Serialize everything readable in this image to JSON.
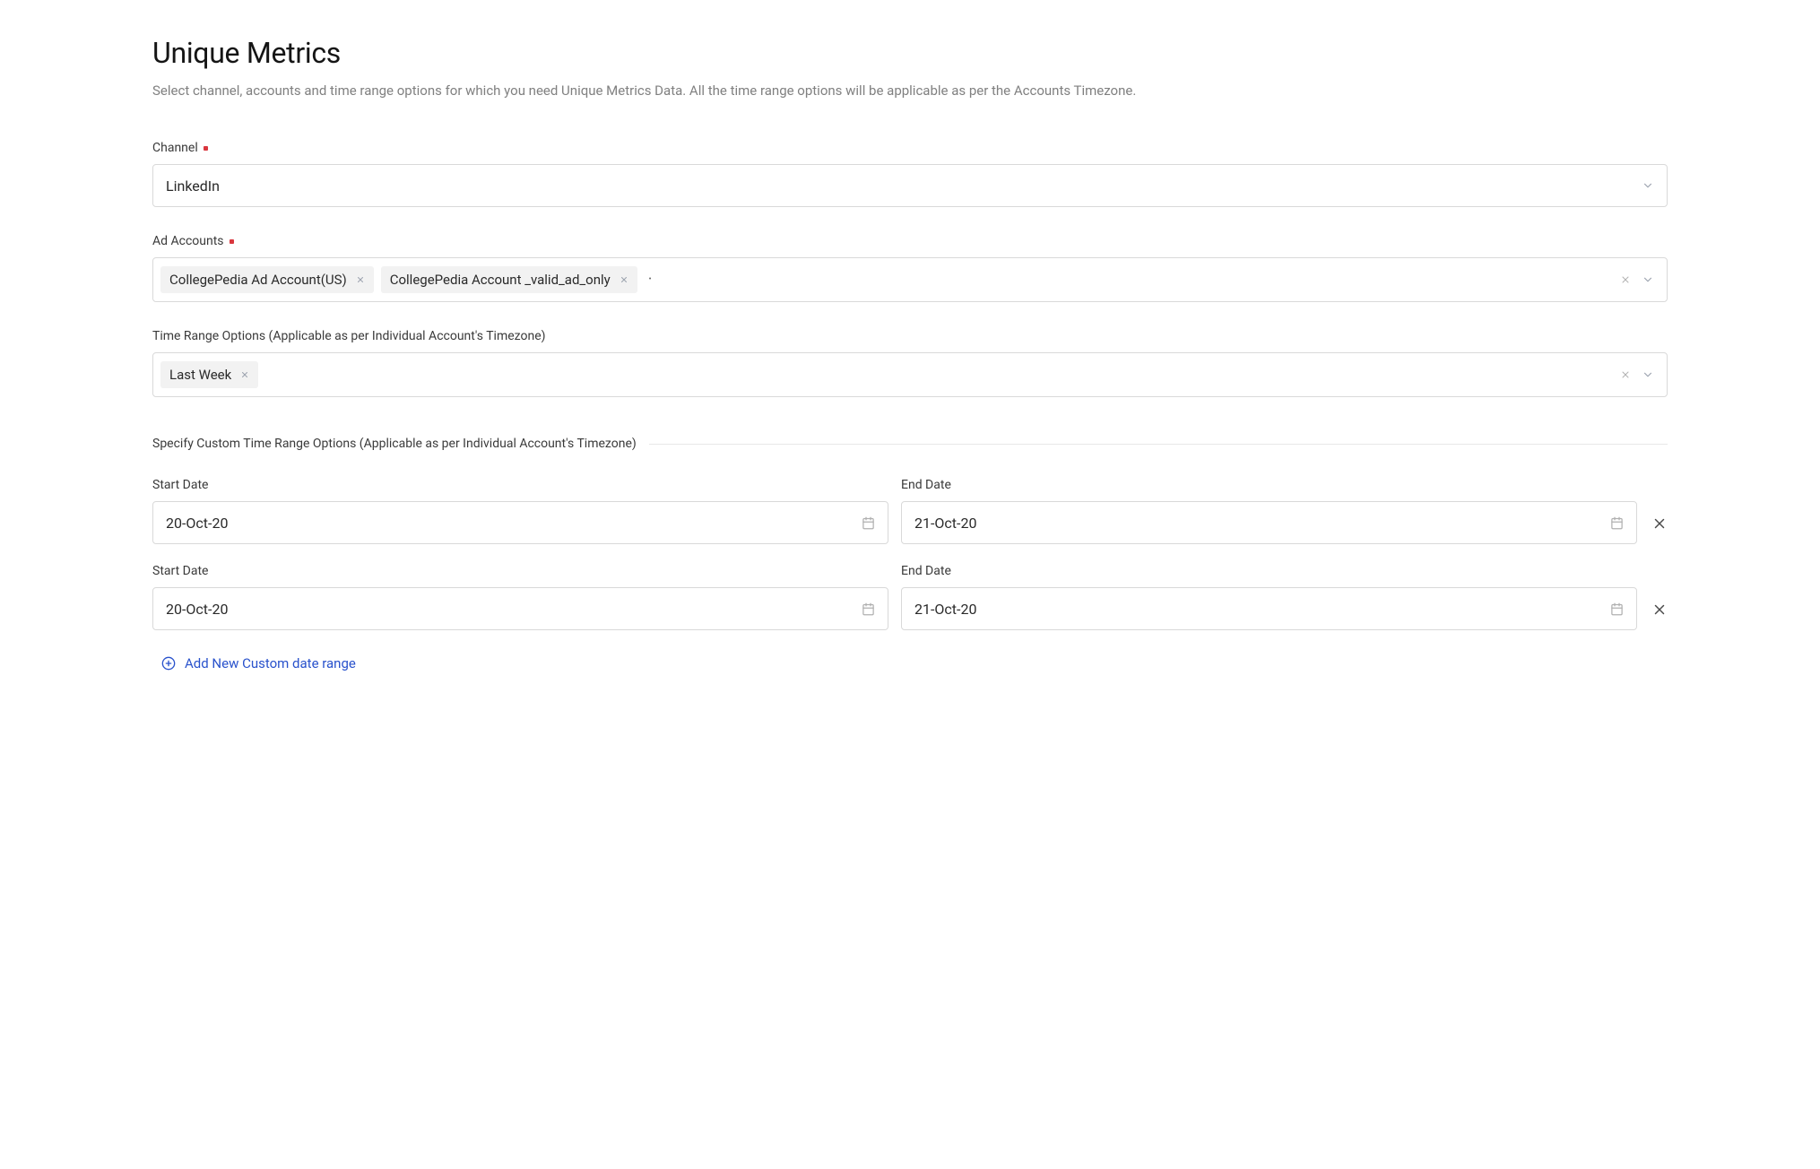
{
  "title": "Unique Metrics",
  "description": "Select channel, accounts and time range options for which you need Unique Metrics Data. All the time range options will be applicable as per the Accounts Timezone.",
  "channel": {
    "label": "Channel",
    "value": "LinkedIn"
  },
  "adAccounts": {
    "label": "Ad Accounts",
    "tags": [
      "CollegePedia Ad Account(US)",
      "CollegePedia Account _valid_ad_only"
    ]
  },
  "timeRange": {
    "label": "Time Range Options (Applicable as per Individual Account's Timezone)",
    "tags": [
      "Last Week"
    ]
  },
  "customSection": {
    "label": "Specify Custom Time Range Options (Applicable as per Individual Account's Timezone)"
  },
  "dateRows": [
    {
      "startLabel": "Start Date",
      "startValue": "20-Oct-20",
      "endLabel": "End Date",
      "endValue": "21-Oct-20"
    },
    {
      "startLabel": "Start Date",
      "startValue": "20-Oct-20",
      "endLabel": "End Date",
      "endValue": "21-Oct-20"
    }
  ],
  "addButton": "Add New Custom date range"
}
